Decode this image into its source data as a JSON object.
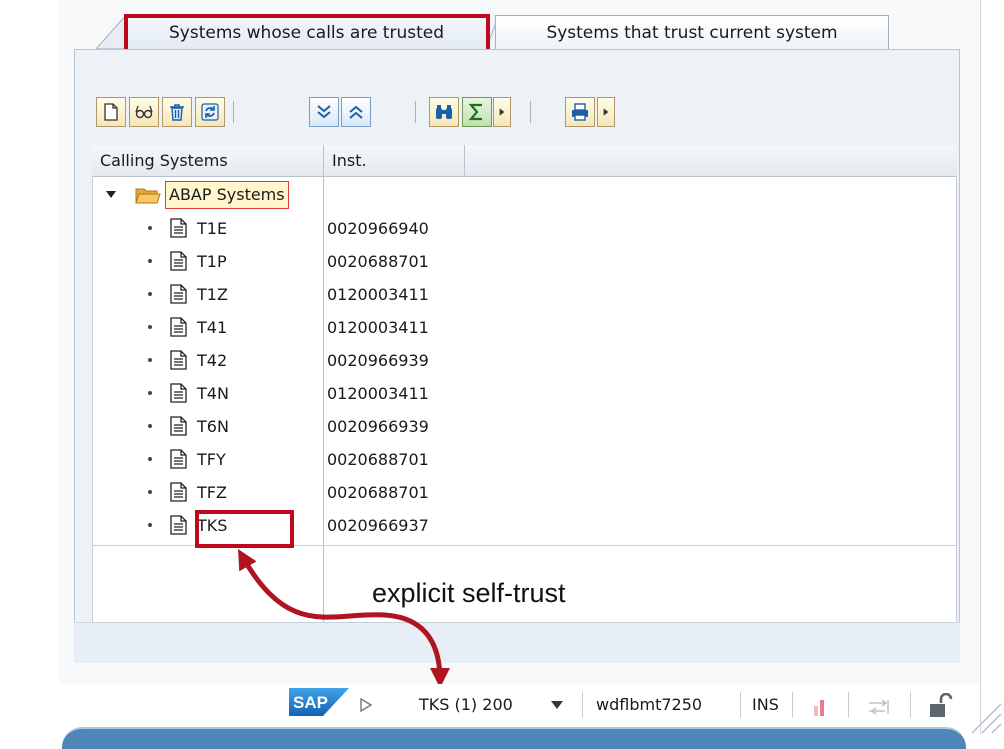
{
  "tabs": {
    "active": "Systems whose calls are trusted",
    "inactive": "Systems that trust current system"
  },
  "toolbar": {
    "buttons": [
      "new-icon",
      "glasses-icon",
      "trash-icon",
      "refresh-icon",
      "expand-all-icon",
      "collapse-all-icon",
      "find-icon",
      "sum-icon",
      "dropdown-arrow-icon",
      "print-icon",
      "dropdown-arrow-icon"
    ]
  },
  "grid": {
    "col1_header": "Calling Systems",
    "col2_header": "Inst.",
    "folder": "ABAP Systems",
    "rows": [
      {
        "name": "T1E",
        "inst": "0020966940"
      },
      {
        "name": "T1P",
        "inst": "0020688701"
      },
      {
        "name": "T1Z",
        "inst": "0120003411"
      },
      {
        "name": "T41",
        "inst": "0120003411"
      },
      {
        "name": "T42",
        "inst": "0020966939"
      },
      {
        "name": "T4N",
        "inst": "0120003411"
      },
      {
        "name": "T6N",
        "inst": "0020966939"
      },
      {
        "name": "TFY",
        "inst": "0020688701"
      },
      {
        "name": "TFZ",
        "inst": "0020688701"
      },
      {
        "name": "TKS",
        "inst": "0020966937"
      }
    ]
  },
  "annotation": "explicit self-trust",
  "status": {
    "logo": "SAP",
    "system": "TKS (1) 200",
    "server": "wdflbmt7250",
    "mode": "INS"
  },
  "colors": {
    "highlight": "#c0081c",
    "sap_blue": "#1f6fc4"
  }
}
